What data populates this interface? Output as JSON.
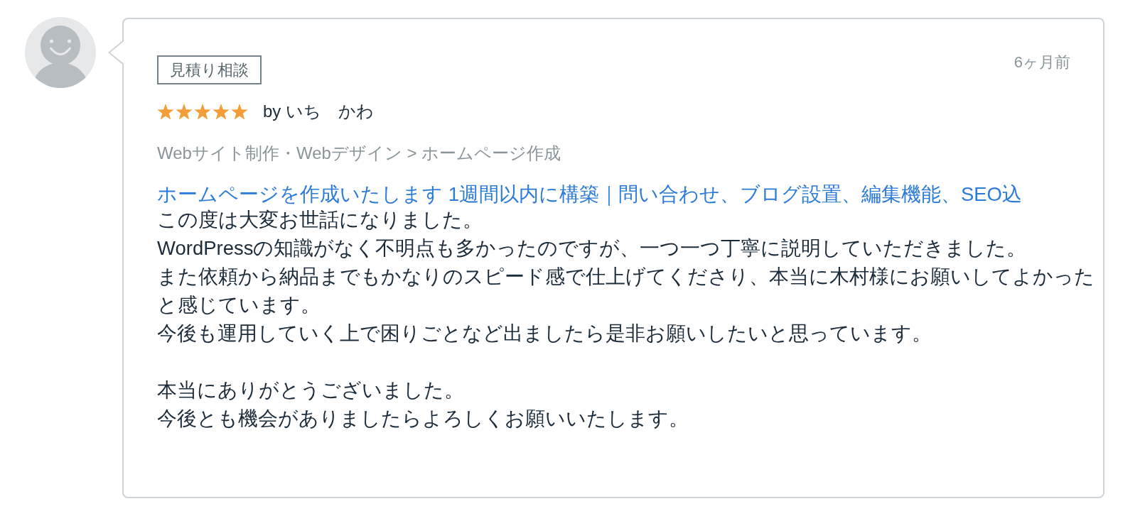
{
  "review": {
    "tag": "見積り相談",
    "time": "6ヶ月前",
    "stars": 5,
    "author": "by いち　かわ",
    "breadcrumb": "Webサイト制作・Webデザイン > ホームページ作成",
    "service_link": "ホームページを作成いたします 1週間以内に構築｜問い合わせ、ブログ設置、編集機能、SEO込",
    "paragraphs": [
      [
        "この度は大変お世話になりました。",
        "WordPressの知識がなく不明点も多かったのですが、一つ一つ丁寧に説明していただきました。",
        "また依頼から納品までもかなりのスピード感で仕上げてくださり、本当に木村様にお願いしてよかったと感じています。",
        "今後も運用していく上で困りごとなど出ましたら是非お願いしたいと思っています。"
      ],
      [
        "本当にありがとうございました。",
        "今後とも機会がありましたらよろしくお願いいたします。"
      ]
    ]
  }
}
